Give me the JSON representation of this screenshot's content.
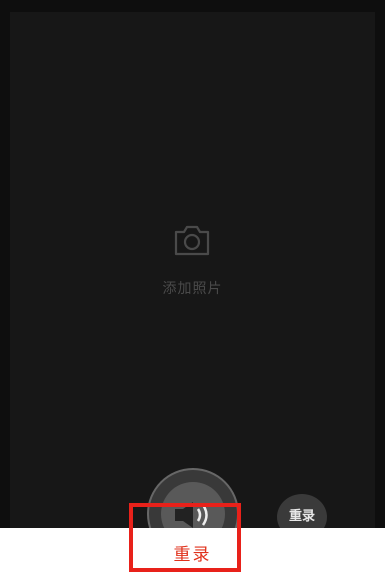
{
  "photo_area": {
    "add_photo_label": "添加照片",
    "icon": "camera-icon"
  },
  "voice": {
    "icon": "speaker-icon"
  },
  "rerecord_small_label": "重录",
  "bottom_bar": {
    "rerecord_label": "重录"
  },
  "colors": {
    "background": "#0e0e0e",
    "photo_area": "#171717",
    "accent_red": "#e0321c",
    "highlight": "#e8211a"
  }
}
